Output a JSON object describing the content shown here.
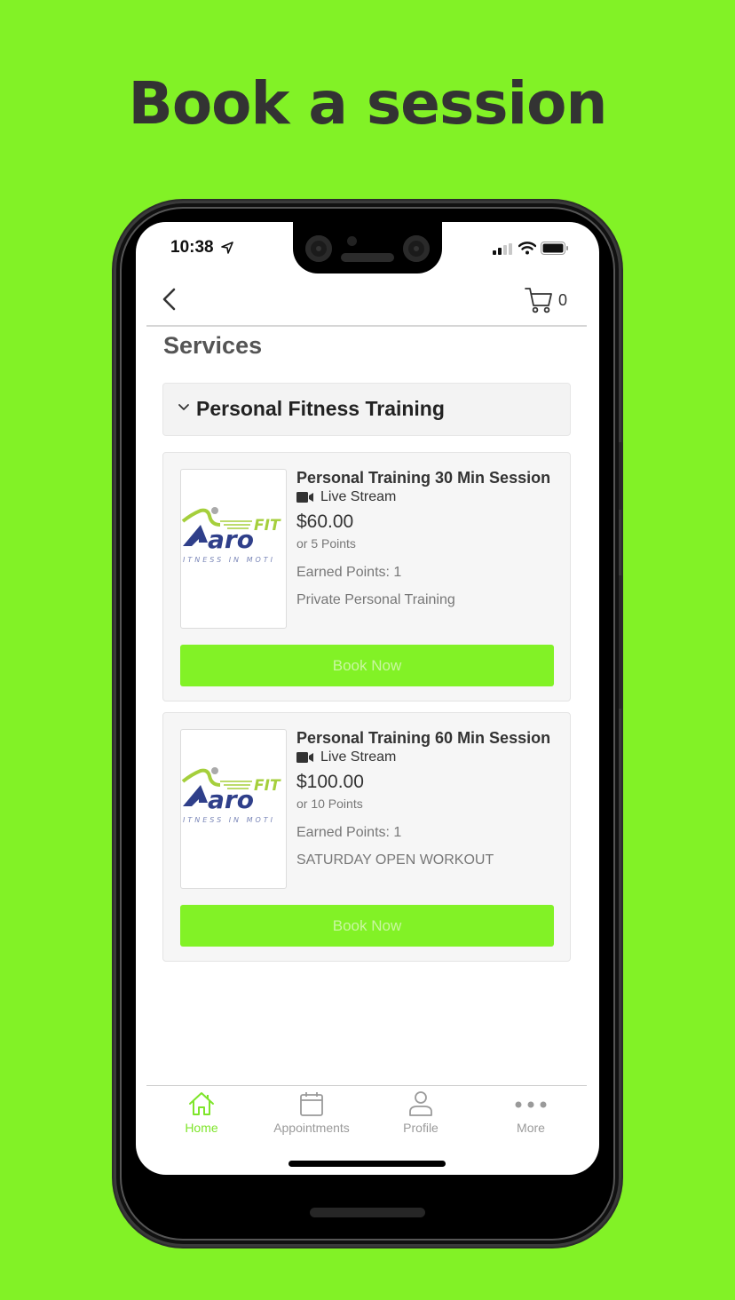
{
  "headline": "Book a session",
  "colors": {
    "brand_green": "#82f226",
    "text_dark": "#333333",
    "active_tab": "#7ee52a"
  },
  "status_bar": {
    "time": "10:38",
    "location_icon": "location-arrow-icon",
    "signal_icon": "cellular-signal-icon",
    "wifi_icon": "wifi-icon",
    "battery_icon": "battery-icon"
  },
  "nav": {
    "back_icon": "chevron-left-icon",
    "cart_icon": "shopping-cart-icon",
    "cart_count": "0"
  },
  "page": {
    "section_title": "Services",
    "category": {
      "label": "Personal Fitness Training",
      "icon": "chevron-down-icon",
      "expanded": true
    },
    "services": [
      {
        "title": "Personal Training 30 Min Session",
        "mode": "Live Stream",
        "mode_icon": "video-camera-icon",
        "price": "$60.00",
        "points_price": "or 5 Points",
        "earned_points": "Earned Points: 1",
        "description": "Private Personal Training",
        "image_alt": "Aaron Fit logo - Fitness in Motion",
        "button_label": "Book Now"
      },
      {
        "title": "Personal Training 60 Min Session",
        "mode": "Live Stream",
        "mode_icon": "video-camera-icon",
        "price": "$100.00",
        "points_price": "or 10 Points",
        "earned_points": "Earned Points: 1",
        "description": "SATURDAY OPEN WORKOUT",
        "image_alt": "Aaron Fit logo - Fitness in Motion",
        "button_label": "Book Now"
      }
    ]
  },
  "logo": {
    "brand_top": "FIT",
    "brand_main": "aro",
    "tagline": "ITNESS IN MOTI"
  },
  "tab_bar": {
    "tabs": [
      {
        "label": "Home",
        "icon": "home-icon",
        "active": true
      },
      {
        "label": "Appointments",
        "icon": "calendar-icon",
        "active": false
      },
      {
        "label": "Profile",
        "icon": "person-icon",
        "active": false
      },
      {
        "label": "More",
        "icon": "more-dots-icon",
        "active": false
      }
    ]
  }
}
